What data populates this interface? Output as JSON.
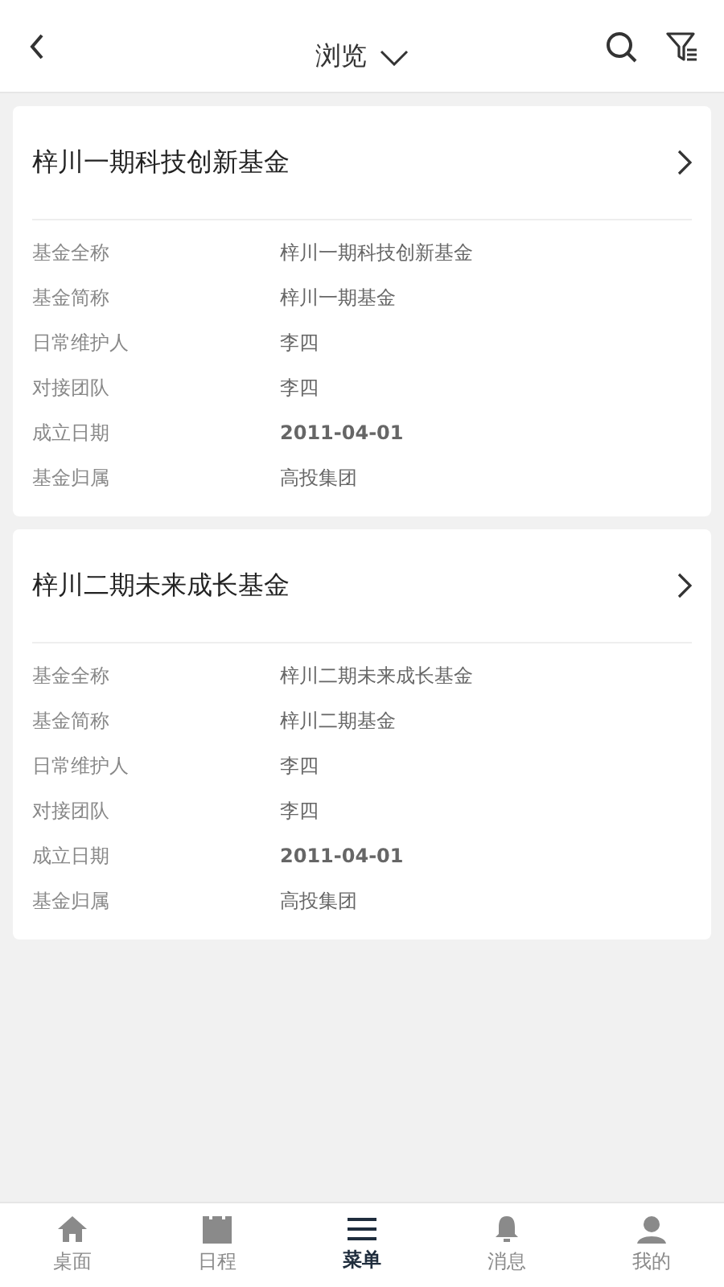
{
  "header": {
    "title": "浏览"
  },
  "funds": [
    {
      "name": "梓川一期科技创新基金",
      "fields": [
        {
          "label": "基金全称",
          "value": "梓川一期科技创新基金",
          "kind": "text"
        },
        {
          "label": "基金简称",
          "value": "梓川一期基金",
          "kind": "text"
        },
        {
          "label": "日常维护人",
          "value": "李四",
          "kind": "text"
        },
        {
          "label": "对接团队",
          "value": "李四",
          "kind": "text"
        },
        {
          "label": "成立日期",
          "value": "2011-04-01",
          "kind": "date"
        },
        {
          "label": "基金归属",
          "value": "高投集团",
          "kind": "text"
        }
      ]
    },
    {
      "name": "梓川二期未来成长基金",
      "fields": [
        {
          "label": "基金全称",
          "value": "梓川二期未来成长基金",
          "kind": "text"
        },
        {
          "label": "基金简称",
          "value": "梓川二期基金",
          "kind": "text"
        },
        {
          "label": "日常维护人",
          "value": "李四",
          "kind": "text"
        },
        {
          "label": "对接团队",
          "value": "李四",
          "kind": "text"
        },
        {
          "label": "成立日期",
          "value": "2011-04-01",
          "kind": "date"
        },
        {
          "label": "基金归属",
          "value": "高投集团",
          "kind": "text"
        }
      ]
    }
  ],
  "tabs": [
    {
      "label": "桌面",
      "kind": "home",
      "selected": false
    },
    {
      "label": "日程",
      "kind": "calendar",
      "selected": false
    },
    {
      "label": "菜单",
      "kind": "menu",
      "selected": true
    },
    {
      "label": "消息",
      "kind": "bell",
      "selected": false
    },
    {
      "label": "我的",
      "kind": "user",
      "selected": false
    }
  ]
}
